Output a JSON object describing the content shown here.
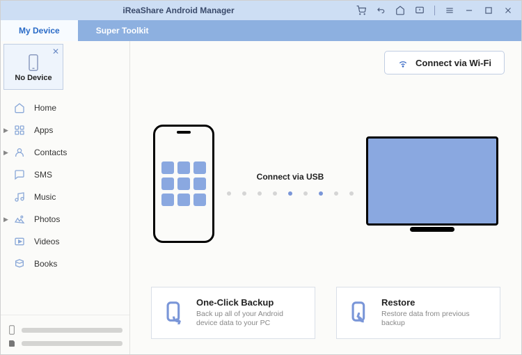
{
  "title": "iReaShare Android Manager",
  "tabs": {
    "mydevice": "My Device",
    "toolkit": "Super Toolkit"
  },
  "device_slot": "No Device",
  "sidebar": [
    {
      "label": "Home",
      "icon": "home-icon",
      "expandable": false
    },
    {
      "label": "Apps",
      "icon": "apps-icon",
      "expandable": true
    },
    {
      "label": "Contacts",
      "icon": "contacts-icon",
      "expandable": true
    },
    {
      "label": "SMS",
      "icon": "sms-icon",
      "expandable": false
    },
    {
      "label": "Music",
      "icon": "music-icon",
      "expandable": false
    },
    {
      "label": "Photos",
      "icon": "photos-icon",
      "expandable": true
    },
    {
      "label": "Videos",
      "icon": "videos-icon",
      "expandable": false
    },
    {
      "label": "Books",
      "icon": "books-icon",
      "expandable": false
    }
  ],
  "wifi_button": "Connect via Wi-Fi",
  "connect_label": "Connect via USB",
  "cards": {
    "backup": {
      "title": "One-Click Backup",
      "sub": "Back up all of your Android device data to your PC"
    },
    "restore": {
      "title": "Restore",
      "sub": "Restore data from previous backup"
    }
  }
}
